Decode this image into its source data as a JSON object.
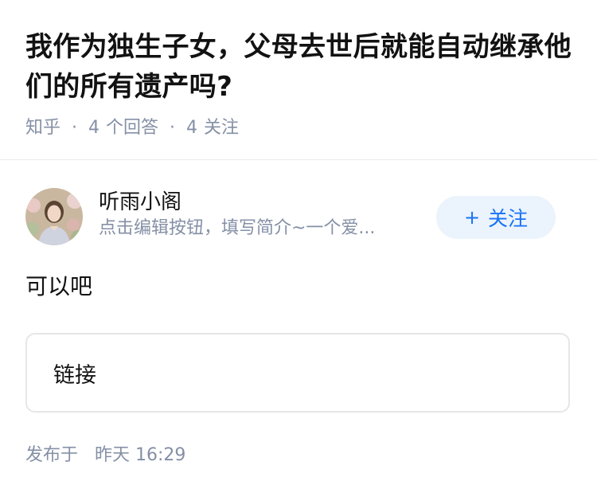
{
  "question": {
    "title": "我作为独生子女，父母去世后就能自动继承他们的所有遗产吗?",
    "source": "知乎",
    "answers_count": "4",
    "answers_label": "个回答",
    "follows_count": "4",
    "follows_label": "关注"
  },
  "author": {
    "name": "听雨小阁",
    "bio": "点击编辑按钮，填写简介~一个爱...",
    "follow_label": "关注",
    "follow_icon": "+"
  },
  "answer": {
    "text": "可以吧",
    "link_label": "链接"
  },
  "publish": {
    "label": "发布于",
    "time": "昨天 16:29"
  },
  "colors": {
    "text": "#121212",
    "muted": "#8590a6",
    "accent": "#1772f6",
    "follow_bg": "#ebf3fc",
    "border": "#e6e6e6"
  }
}
